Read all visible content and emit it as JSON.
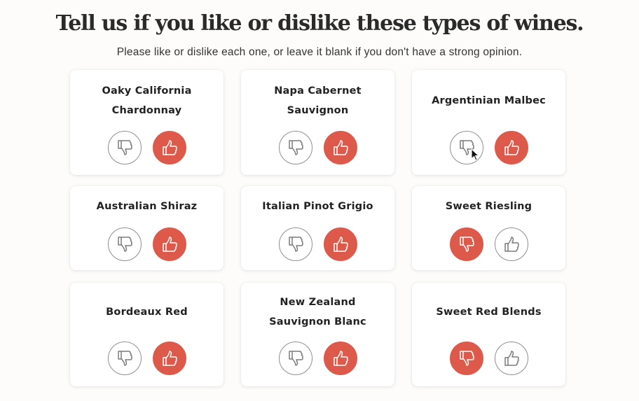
{
  "header": {
    "title": "Tell us if you like or dislike these types of wines.",
    "subtitle": "Please like or dislike each one, or leave it blank if you don't have a strong opinion."
  },
  "colors": {
    "accent": "#dd5a4b",
    "inactive_border": "#8f8f8f"
  },
  "wines": [
    {
      "line1": "Oaky California",
      "line2": "Chardonnay",
      "order": [
        "dislike",
        "like"
      ],
      "selected": "like"
    },
    {
      "line1": "Napa Cabernet",
      "line2": "Sauvignon",
      "order": [
        "dislike",
        "like"
      ],
      "selected": "like"
    },
    {
      "line1": "Argentinian Malbec",
      "line2": "",
      "order": [
        "dislike",
        "like"
      ],
      "selected": "like"
    },
    {
      "line1": "Australian Shiraz",
      "line2": "",
      "order": [
        "dislike",
        "like"
      ],
      "selected": "like"
    },
    {
      "line1": "Italian Pinot Grigio",
      "line2": "",
      "order": [
        "dislike",
        "like"
      ],
      "selected": "like"
    },
    {
      "line1": "Sweet Riesling",
      "line2": "",
      "order": [
        "dislike",
        "like"
      ],
      "selected": "dislike"
    },
    {
      "line1": "Bordeaux Red",
      "line2": "",
      "order": [
        "dislike",
        "like"
      ],
      "selected": "like"
    },
    {
      "line1": "New Zealand",
      "line2": "Sauvignon Blanc",
      "order": [
        "dislike",
        "like"
      ],
      "selected": "like"
    },
    {
      "line1": "Sweet Red Blends",
      "line2": "",
      "order": [
        "dislike",
        "like"
      ],
      "selected": "dislike"
    }
  ],
  "icons": {
    "like": "thumbs-up-icon",
    "dislike": "thumbs-down-icon",
    "pointer": "mouse-cursor-icon"
  }
}
